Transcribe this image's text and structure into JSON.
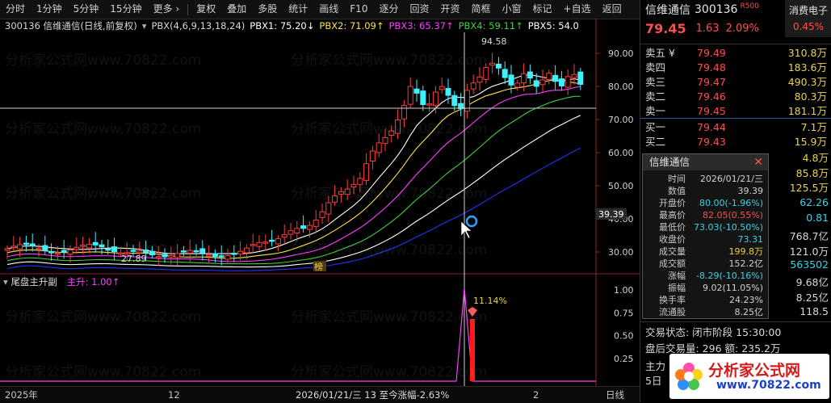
{
  "toolbar": {
    "left_items": [
      "分时",
      "1分钟",
      "5分钟",
      "15分钟",
      "更多 ›"
    ],
    "right_items": [
      "复权",
      "叠加",
      "多股",
      "统计",
      "画线",
      "F10",
      "逐分",
      "回资",
      "开资",
      "简框",
      "小窗",
      "标记",
      "+自选",
      "返回"
    ]
  },
  "chart_title": {
    "code_name": "300136 信维通信(日线,前复权)",
    "indicator": "PBX(4,6,9,13,18,24)",
    "pbx1": "PBX1: 75.20↓",
    "pbx2": "PBX2: 71.09↑",
    "pbx3": "PBX3: 65.37↑",
    "pbx4": "PBX4: 59.11↑",
    "pbx5": "PBX5: 54.0"
  },
  "price_axis": {
    "labels": [
      "90.00",
      "80.00",
      "70.00",
      "60.00",
      "50.00",
      "40.00",
      "30.00"
    ],
    "cursor_value": "39.39"
  },
  "annotations": {
    "high": "94.58",
    "low": "27.89",
    "badge": "榜"
  },
  "sub_indicator": {
    "title": "尾盘主升副",
    "value": "主升: 1.00↑",
    "peak_label": "11.14%",
    "axis_labels": [
      "1.00",
      "0.75",
      "0.50",
      "0.25"
    ]
  },
  "bottom_bar": {
    "year": "2025年",
    "m12": "12",
    "date_info": "2026/01/21/三  13  至今涨幅-2.63%",
    "m2": "2",
    "period": "日线"
  },
  "right_panel": {
    "stock_name": "信维通信",
    "code": "300136",
    "tag": "R500",
    "sector": "消费电子",
    "price": "79.45",
    "change": "1.63",
    "change_pct": "2.09%",
    "sector_pct": "0.45%",
    "sell": [
      {
        "label": "卖五 ¥",
        "price": "79.49",
        "vol": "310.8万"
      },
      {
        "label": "卖四",
        "price": "79.48",
        "vol": "183.6万"
      },
      {
        "label": "卖三",
        "price": "79.47",
        "vol": "490.3万"
      },
      {
        "label": "卖二",
        "price": "79.46",
        "vol": "80.3万"
      },
      {
        "label": "卖一",
        "price": "79.45",
        "vol": "181.1万"
      }
    ],
    "buy": [
      {
        "label": "买一",
        "price": "79.44",
        "vol": "7.1万"
      },
      {
        "label": "买二",
        "price": "79.43",
        "vol": "15.9万"
      }
    ],
    "extra_values": [
      "4.8万",
      "85.8万",
      "125.5万",
      "62.26",
      "0.81",
      "768.7亿",
      "121.0万",
      "563502",
      "9.68亿",
      "8.25亿",
      "118.5"
    ],
    "trade_status": "交易状态: 闭市阶段 15:30:00",
    "after_hours": "盘后交易量: 296  额: 235.2万",
    "cut1": "主力",
    "cut2": "5日"
  },
  "popup": {
    "title": "信维通信",
    "rows": [
      {
        "k": "时间",
        "v": "2026/01/21/三",
        "c": "#d0d0d0"
      },
      {
        "k": "数值",
        "v": "39.39",
        "c": "#d0d0d0"
      },
      {
        "k": "开盘价",
        "v": "80.00(-1.96%)",
        "c": "#35d4e6"
      },
      {
        "k": "最高价",
        "v": "82.05(0.55%)",
        "c": "#ff4d4d"
      },
      {
        "k": "最低价",
        "v": "73.03(-10.50%)",
        "c": "#35d4e6"
      },
      {
        "k": "收盘价",
        "v": "73.31",
        "c": "#35d4e6"
      },
      {
        "k": "成交量",
        "v": "199.8万",
        "c": "#e6d23c"
      },
      {
        "k": "成交额",
        "v": "152.2亿",
        "c": "#d0d0d0"
      },
      {
        "k": "涨幅",
        "v": "-8.29(-10.16%)",
        "c": "#35d4e6"
      },
      {
        "k": "振幅",
        "v": "9.02(11.05%)",
        "c": "#d0d0d0"
      },
      {
        "k": "换手率",
        "v": "24.23%",
        "c": "#d0d0d0"
      },
      {
        "k": "流通股",
        "v": "8.25亿",
        "c": "#d0d0d0"
      }
    ]
  },
  "watermark": {
    "text": "分析家公式网www.70822.com",
    "logo": "分析家公式网",
    "logo_url": "www.70822.com"
  },
  "colors": {
    "up": "#ff3b3b",
    "down": "#3ff0ff",
    "bg": "#000000",
    "ma1": "#ffffff",
    "ma2": "#ffe14d",
    "ma3": "#ff3cff",
    "ma4": "#3cd23c",
    "ma5": "#ffffff",
    "ma6": "#2233ff"
  }
}
